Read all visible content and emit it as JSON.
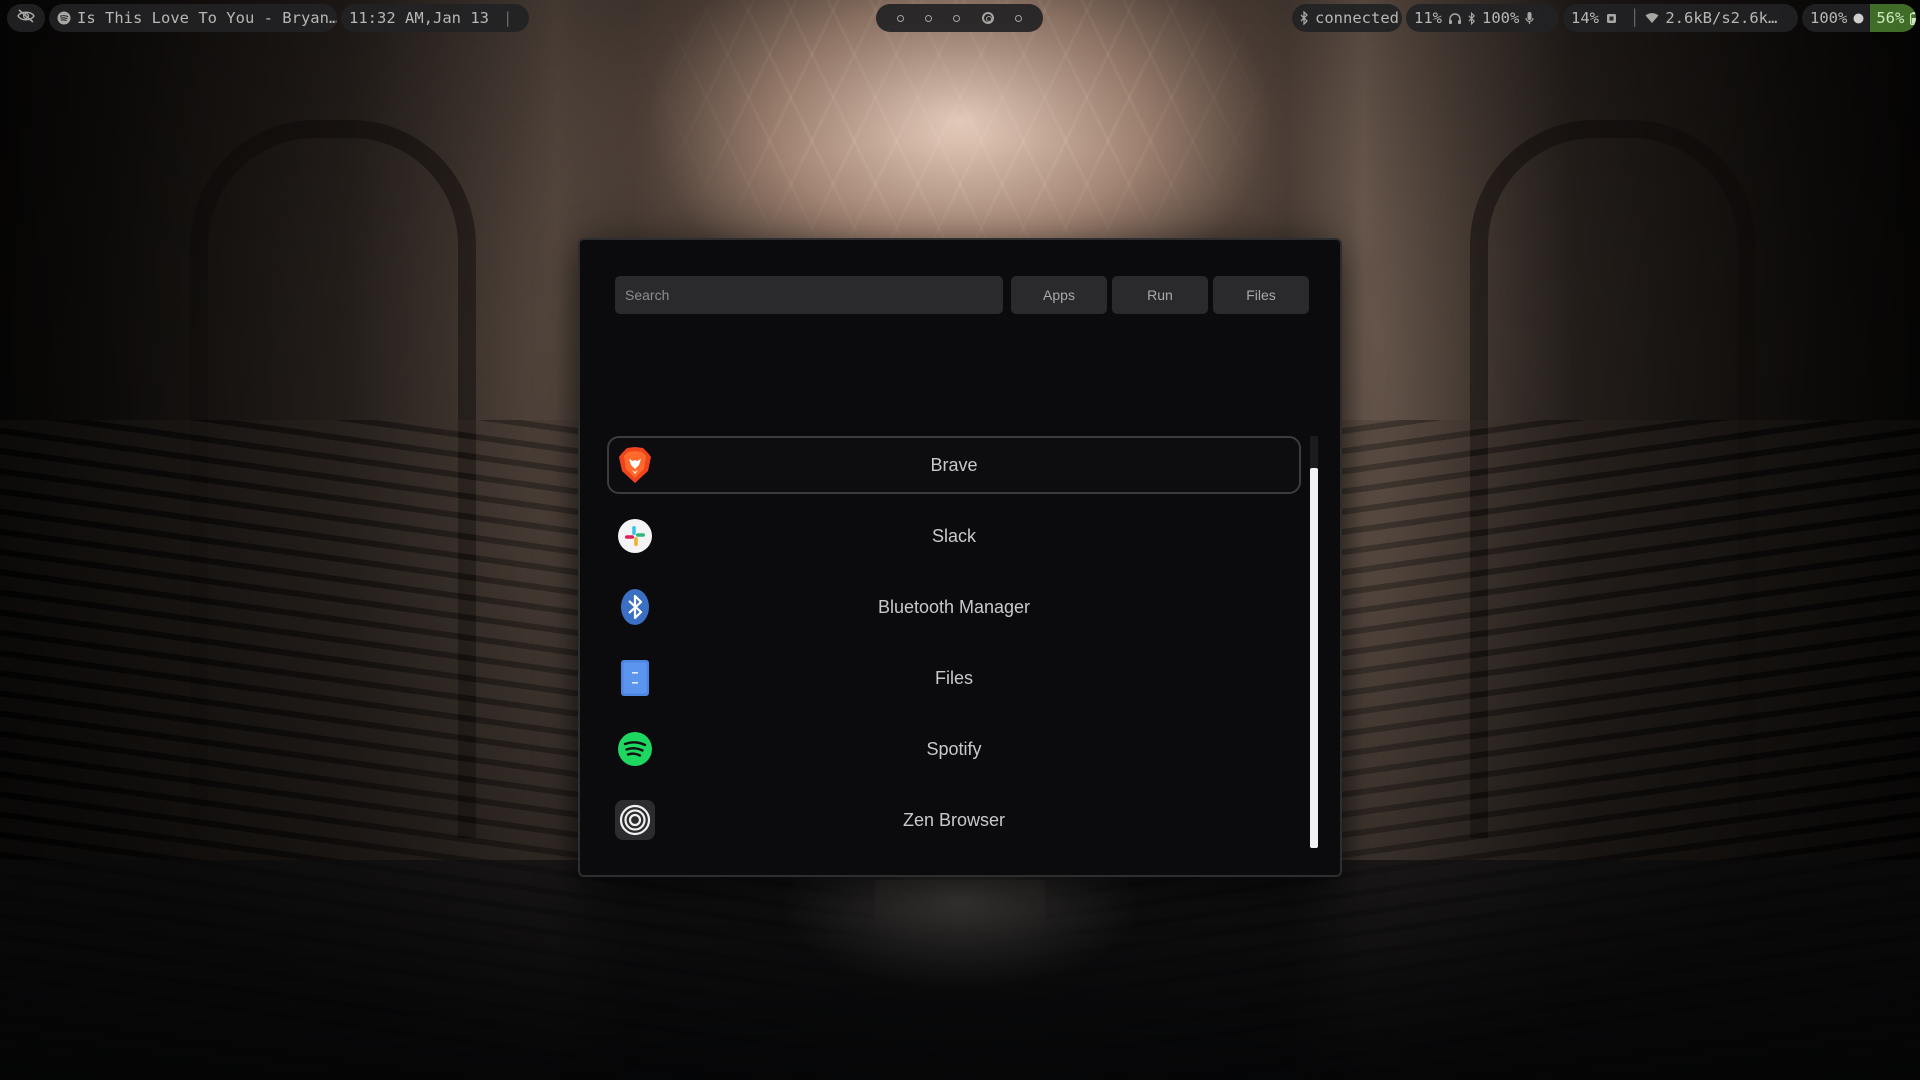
{
  "topbar": {
    "left": {
      "visibility_icon": "eye-off-icon",
      "media_icon": "spotify-icon",
      "media_title": "Is This Love To You - Bryan…",
      "clock": "11:32 AM,Jan 13",
      "separator": "|"
    },
    "workspaces": [
      {
        "icon": "circle-icon",
        "active": false
      },
      {
        "icon": "circle-icon",
        "active": false
      },
      {
        "icon": "circle-icon",
        "active": false
      },
      {
        "icon": "target-circle-icon",
        "active": true
      },
      {
        "icon": "circle-icon",
        "active": false
      }
    ],
    "right": {
      "bluetooth_status": "connected",
      "volume": "11%",
      "bluetooth_device_battery": "100%",
      "mic": "14%",
      "network_speed": "2.6kB/s2.6k…",
      "brightness": "100%",
      "battery": "56%"
    }
  },
  "launcher": {
    "search": {
      "placeholder": "Search",
      "value": ""
    },
    "modes": {
      "apps": "Apps",
      "run": "Run",
      "files": "Files"
    },
    "apps": [
      {
        "name": "Brave",
        "icon": "brave-icon",
        "selected": true
      },
      {
        "name": "Slack",
        "icon": "slack-icon",
        "selected": false
      },
      {
        "name": "Bluetooth Manager",
        "icon": "bluetooth-icon",
        "selected": false
      },
      {
        "name": "Files",
        "icon": "files-icon",
        "selected": false
      },
      {
        "name": "Spotify",
        "icon": "spotify-icon",
        "selected": false
      },
      {
        "name": "Zen Browser",
        "icon": "zen-browser-icon",
        "selected": false
      }
    ]
  },
  "colors": {
    "launcher_bg": "#0b0b0d",
    "input_bg": "#2a2a2d",
    "battery_bg": "#3f6d27",
    "text": "#c9c9cc"
  }
}
